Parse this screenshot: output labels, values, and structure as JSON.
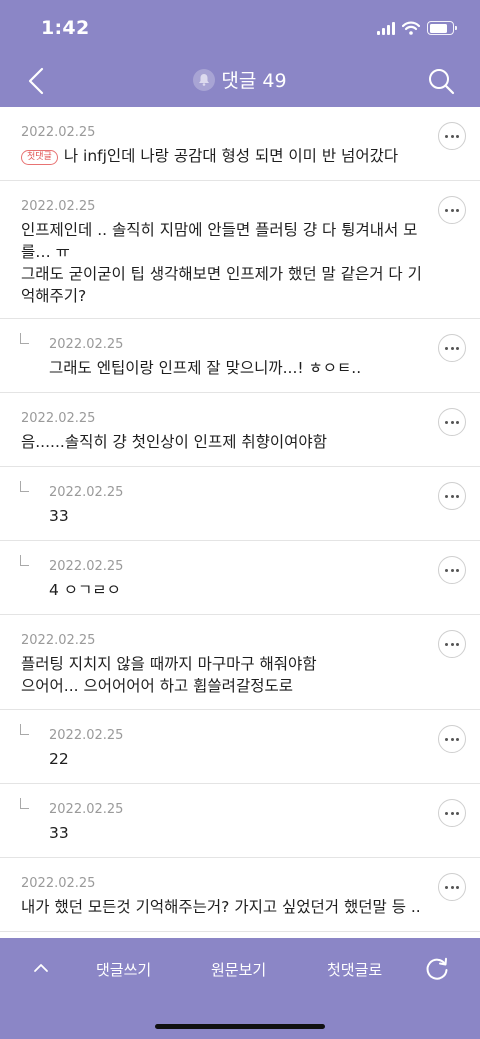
{
  "status": {
    "time": "1:42"
  },
  "header": {
    "title": "댓글 49"
  },
  "comments": [
    {
      "date": "2022.02.25",
      "badge": "첫댓글",
      "text": "나 infj인데 나랑 공감대 형성 되면 이미 반 넘어갔다"
    },
    {
      "date": "2022.02.25",
      "text": "인프제인데 .. 솔직히 지맘에 안들면 플러팅 걍 다 튕겨내서 모를… ㅠ"
    },
    {
      "text": "그래도 굳이굳이 팁 생각해보면 인프제가 했던 말 같은거 다 기억해주기?"
    },
    {
      "date": "2022.02.25",
      "text": "그래도 엔팁이랑 인프제 잘 맞으니까...! ㅎㅇㅌ.."
    },
    {
      "date": "2022.02.25",
      "text": "음......솔직히 걍 첫인상이 인프제 취향이여야함"
    },
    {
      "date": "2022.02.25",
      "text": "33"
    },
    {
      "date": "2022.02.25",
      "text": "4 ㅇㄱㄹㅇ"
    },
    {
      "date": "2022.02.25",
      "text": "플러팅 지치지 않을 때까지 마구마구 해줘야함"
    },
    {
      "text": "으어어... 으어어어어 하고 휩쓸려갈정도로"
    },
    {
      "date": "2022.02.25",
      "text": "22"
    },
    {
      "date": "2022.02.25",
      "text": "33"
    },
    {
      "date": "2022.02.25",
      "text": "내가 했던 모든것 기억해주는거? 가지고 싶었던거 했던말 등 .."
    }
  ],
  "bottom_bar": {
    "write_label": "댓글쓰기",
    "original_label": "원문보기",
    "first_label": "첫댓글로"
  },
  "colors": {
    "accent": "#8b86c6",
    "badge": "#e05454"
  }
}
